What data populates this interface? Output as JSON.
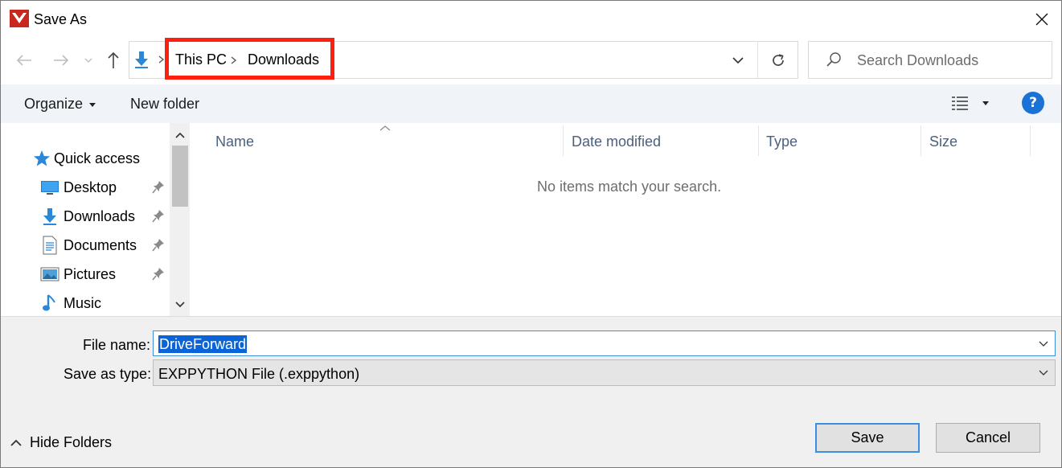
{
  "window": {
    "title": "Save As",
    "app_icon": "app-logo-icon",
    "close_icon": "close-icon"
  },
  "nav": {
    "back_icon": "back-arrow-icon",
    "forward_icon": "forward-arrow-icon",
    "recent_icon": "chevron-down-icon",
    "up_icon": "up-arrow-icon"
  },
  "address": {
    "location_icon": "downloads-icon",
    "breadcrumbs": [
      "This PC",
      "Downloads"
    ],
    "highlight_color": "#ff1f10",
    "dropdown_icon": "chevron-down-icon",
    "refresh_icon": "refresh-icon"
  },
  "search": {
    "placeholder": "Search Downloads",
    "icon": "search-icon"
  },
  "toolbar": {
    "organize_label": "Organize",
    "new_folder_label": "New folder",
    "view_icon": "details-view-icon",
    "help_label": "?"
  },
  "sidebar": {
    "items": [
      {
        "label": "Quick access",
        "icon": "star-icon",
        "pinned": false
      },
      {
        "label": "Desktop",
        "icon": "desktop-icon",
        "pinned": true
      },
      {
        "label": "Downloads",
        "icon": "downloads-icon",
        "pinned": true
      },
      {
        "label": "Documents",
        "icon": "documents-icon",
        "pinned": true
      },
      {
        "label": "Pictures",
        "icon": "pictures-icon",
        "pinned": true
      },
      {
        "label": "Music",
        "icon": "music-icon",
        "pinned": false
      }
    ]
  },
  "files": {
    "columns": [
      "Name",
      "Date modified",
      "Type",
      "Size"
    ],
    "empty_message": "No items match your search."
  },
  "form": {
    "file_name_label": "File name:",
    "file_name_value": "DriveForward",
    "save_type_label": "Save as type:",
    "save_type_value": "EXPPYTHON File (.exppython)"
  },
  "footer": {
    "hide_folders_label": "Hide Folders",
    "save_label": "Save",
    "cancel_label": "Cancel"
  },
  "colors": {
    "accent": "#0a64d8",
    "toolbar_bg": "#f0f4f9",
    "dialog_bg": "#f0f0f0"
  }
}
